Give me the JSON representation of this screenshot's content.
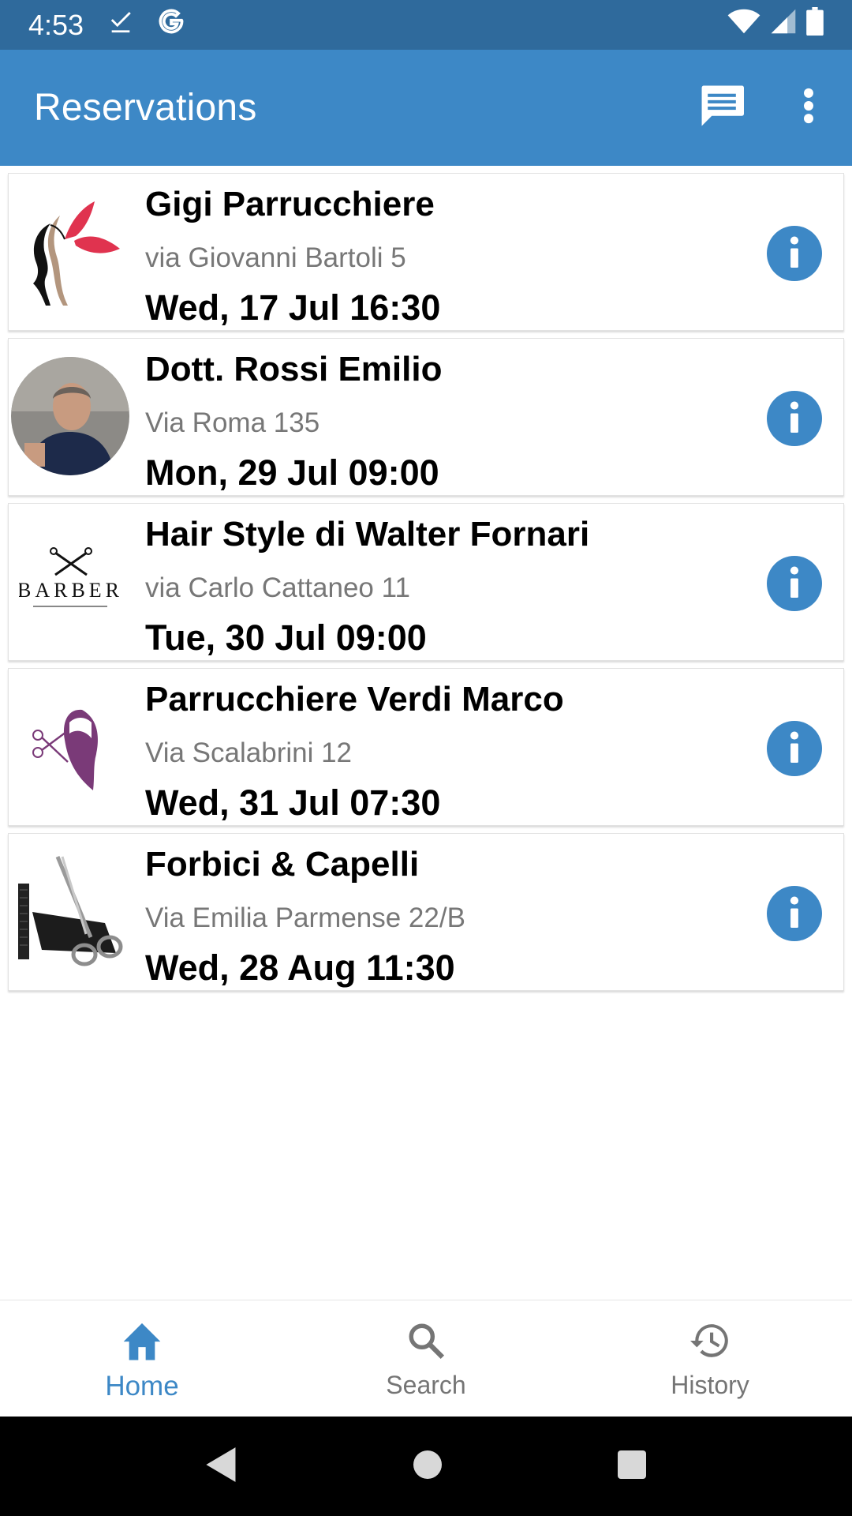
{
  "status_bar": {
    "time": "4:53",
    "icons_left": [
      "download-done-icon",
      "google-icon"
    ],
    "icons_right": [
      "wifi-icon",
      "signal-icon",
      "battery-icon"
    ]
  },
  "app_bar": {
    "title": "Reservations",
    "actions": [
      "chat-icon",
      "more-vert-icon"
    ],
    "color": "#3d88c6"
  },
  "reservations": [
    {
      "name": "Gigi Parrucchiere",
      "address": "via Giovanni Bartoli 5",
      "datetime": "Wed, 17 Jul 16:30",
      "thumbnail": "woman-butterfly-logo"
    },
    {
      "name": "Dott. Rossi Emilio",
      "address": "Via Roma 135",
      "datetime": "Mon, 29 Jul 09:00",
      "thumbnail": "person-photo"
    },
    {
      "name": "Hair Style di Walter Fornari",
      "address": "via Carlo Cattaneo 11",
      "datetime": "Tue, 30 Jul 09:00",
      "thumbnail": "barber-logo",
      "thumbnail_text": "BARBER"
    },
    {
      "name": "Parrucchiere Verdi Marco",
      "address": "Via Scalabrini 12",
      "datetime": "Wed, 31 Jul 07:30",
      "thumbnail": "scissors-hair-logo"
    },
    {
      "name": "Forbici & Capelli",
      "address": "Via Emilia Parmense 22/B",
      "datetime": "Wed, 28 Aug 11:30",
      "thumbnail": "scissors-comb-photo"
    }
  ],
  "bottom_nav": {
    "items": [
      {
        "label": "Home",
        "icon": "home-icon",
        "active": true
      },
      {
        "label": "Search",
        "icon": "search-icon",
        "active": false
      },
      {
        "label": "History",
        "icon": "history-icon",
        "active": false
      }
    ]
  },
  "system_nav": [
    "back-icon",
    "home-circle-icon",
    "recents-icon"
  ]
}
